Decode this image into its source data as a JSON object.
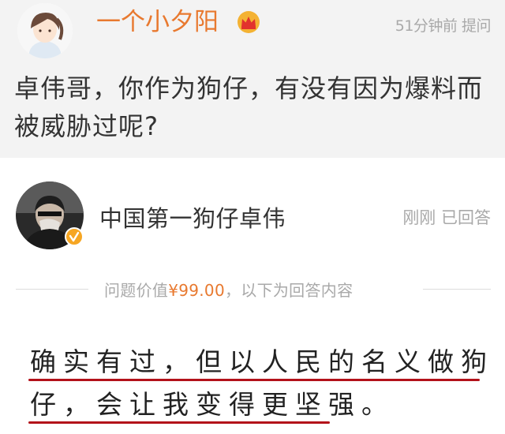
{
  "question": {
    "asker_name": "一个小夕阳",
    "time": "51分钟前",
    "action": "提问",
    "text": "卓伟哥，你作为狗仔，有没有因为爆料而被威胁过呢?"
  },
  "answer": {
    "answerer_name": "中国第一狗仔卓伟",
    "time": "刚刚",
    "status": "已回答",
    "price_prefix": "问题价值",
    "price": "¥99.00",
    "price_suffix": "，以下为回答内容",
    "text": "确实有过，但以人民的名义做狗仔，会让我变得更坚强。"
  },
  "icons": {
    "crown": "crown-icon",
    "verified": "verified-badge-icon"
  },
  "colors": {
    "accent": "#e8792f",
    "underline": "#b3121a",
    "question_bg": "#f3f3f3",
    "meta_text": "#a9a9a9"
  }
}
